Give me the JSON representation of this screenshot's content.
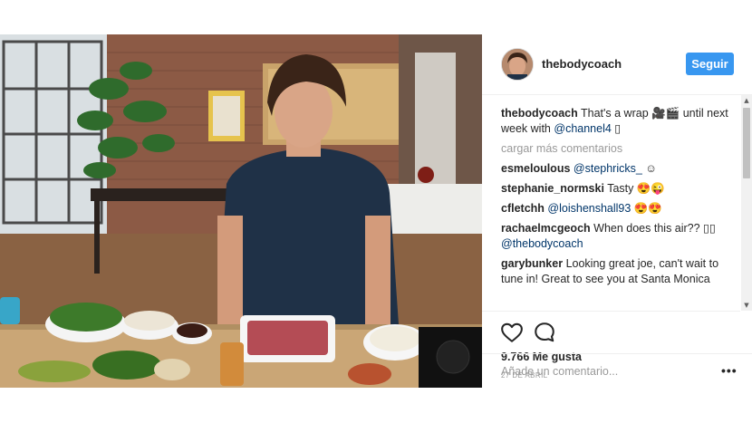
{
  "post": {
    "username": "thebodycoach",
    "follow_label": "Seguir",
    "caption": {
      "user": "thebodycoach",
      "text": "That's a wrap 🎥🎬 until next week with",
      "mention": "@channel4",
      "suffix": " ▯"
    },
    "load_more_label": "cargar más comentarios",
    "comments": [
      {
        "user": "esmeloulous",
        "mention": "@stephricks_",
        "text": " ☺"
      },
      {
        "user": "stephanie_normski",
        "mention": "",
        "text": "Tasty 😍😜"
      },
      {
        "user": "cfletchh",
        "mention": "@loishenshall93",
        "text": " 😍😍"
      },
      {
        "user": "rachaelmcgeoch",
        "mention": "",
        "text": "When does this air?? ▯▯",
        "mention_after": "@thebodycoach"
      },
      {
        "user": "garybunker",
        "mention": "",
        "text": "Looking great joe, can't wait to tune in! Great to see you at Santa Monica"
      }
    ],
    "likes": "9.766 Me gusta",
    "date": "27 DE ABRIL",
    "add_comment_placeholder": "Añade un comentario...",
    "more_label": "•••"
  },
  "icons": {
    "like": "heart-icon",
    "comment": "comment-bubble-icon",
    "more": "more-options-icon"
  },
  "colors": {
    "accent": "#3897f0",
    "text": "#262626",
    "muted": "#999999",
    "mention": "#003569"
  }
}
